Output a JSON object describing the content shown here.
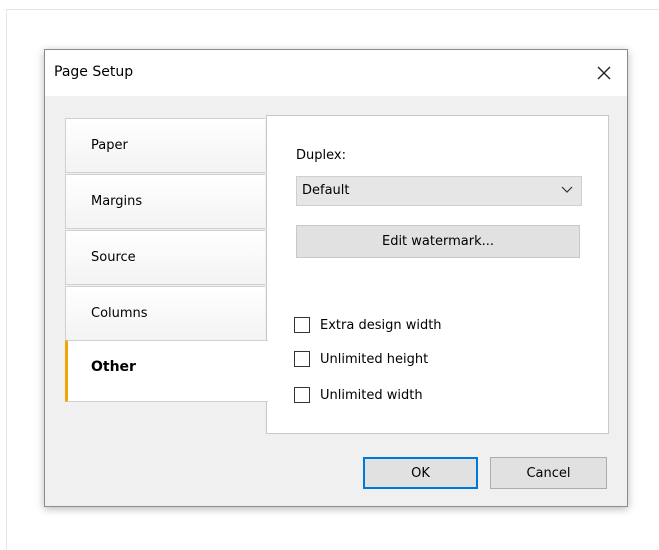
{
  "dialog": {
    "title": "Page Setup",
    "close_icon": "close-icon"
  },
  "tabs": [
    {
      "label": "Paper",
      "active": false
    },
    {
      "label": "Margins",
      "active": false
    },
    {
      "label": "Source",
      "active": false
    },
    {
      "label": "Columns",
      "active": false
    },
    {
      "label": "Other",
      "active": true
    }
  ],
  "accent_color": "#f0a30a",
  "other_panel": {
    "duplex_label": "Duplex:",
    "duplex_value": "Default",
    "duplex_chevron_icon": "chevron-down-icon",
    "watermark_button": "Edit watermark...",
    "checkboxes": [
      {
        "label": "Extra design width",
        "checked": false
      },
      {
        "label": "Unlimited height",
        "checked": false
      },
      {
        "label": "Unlimited width",
        "checked": false
      }
    ]
  },
  "footer": {
    "ok_label": "OK",
    "cancel_label": "Cancel"
  }
}
